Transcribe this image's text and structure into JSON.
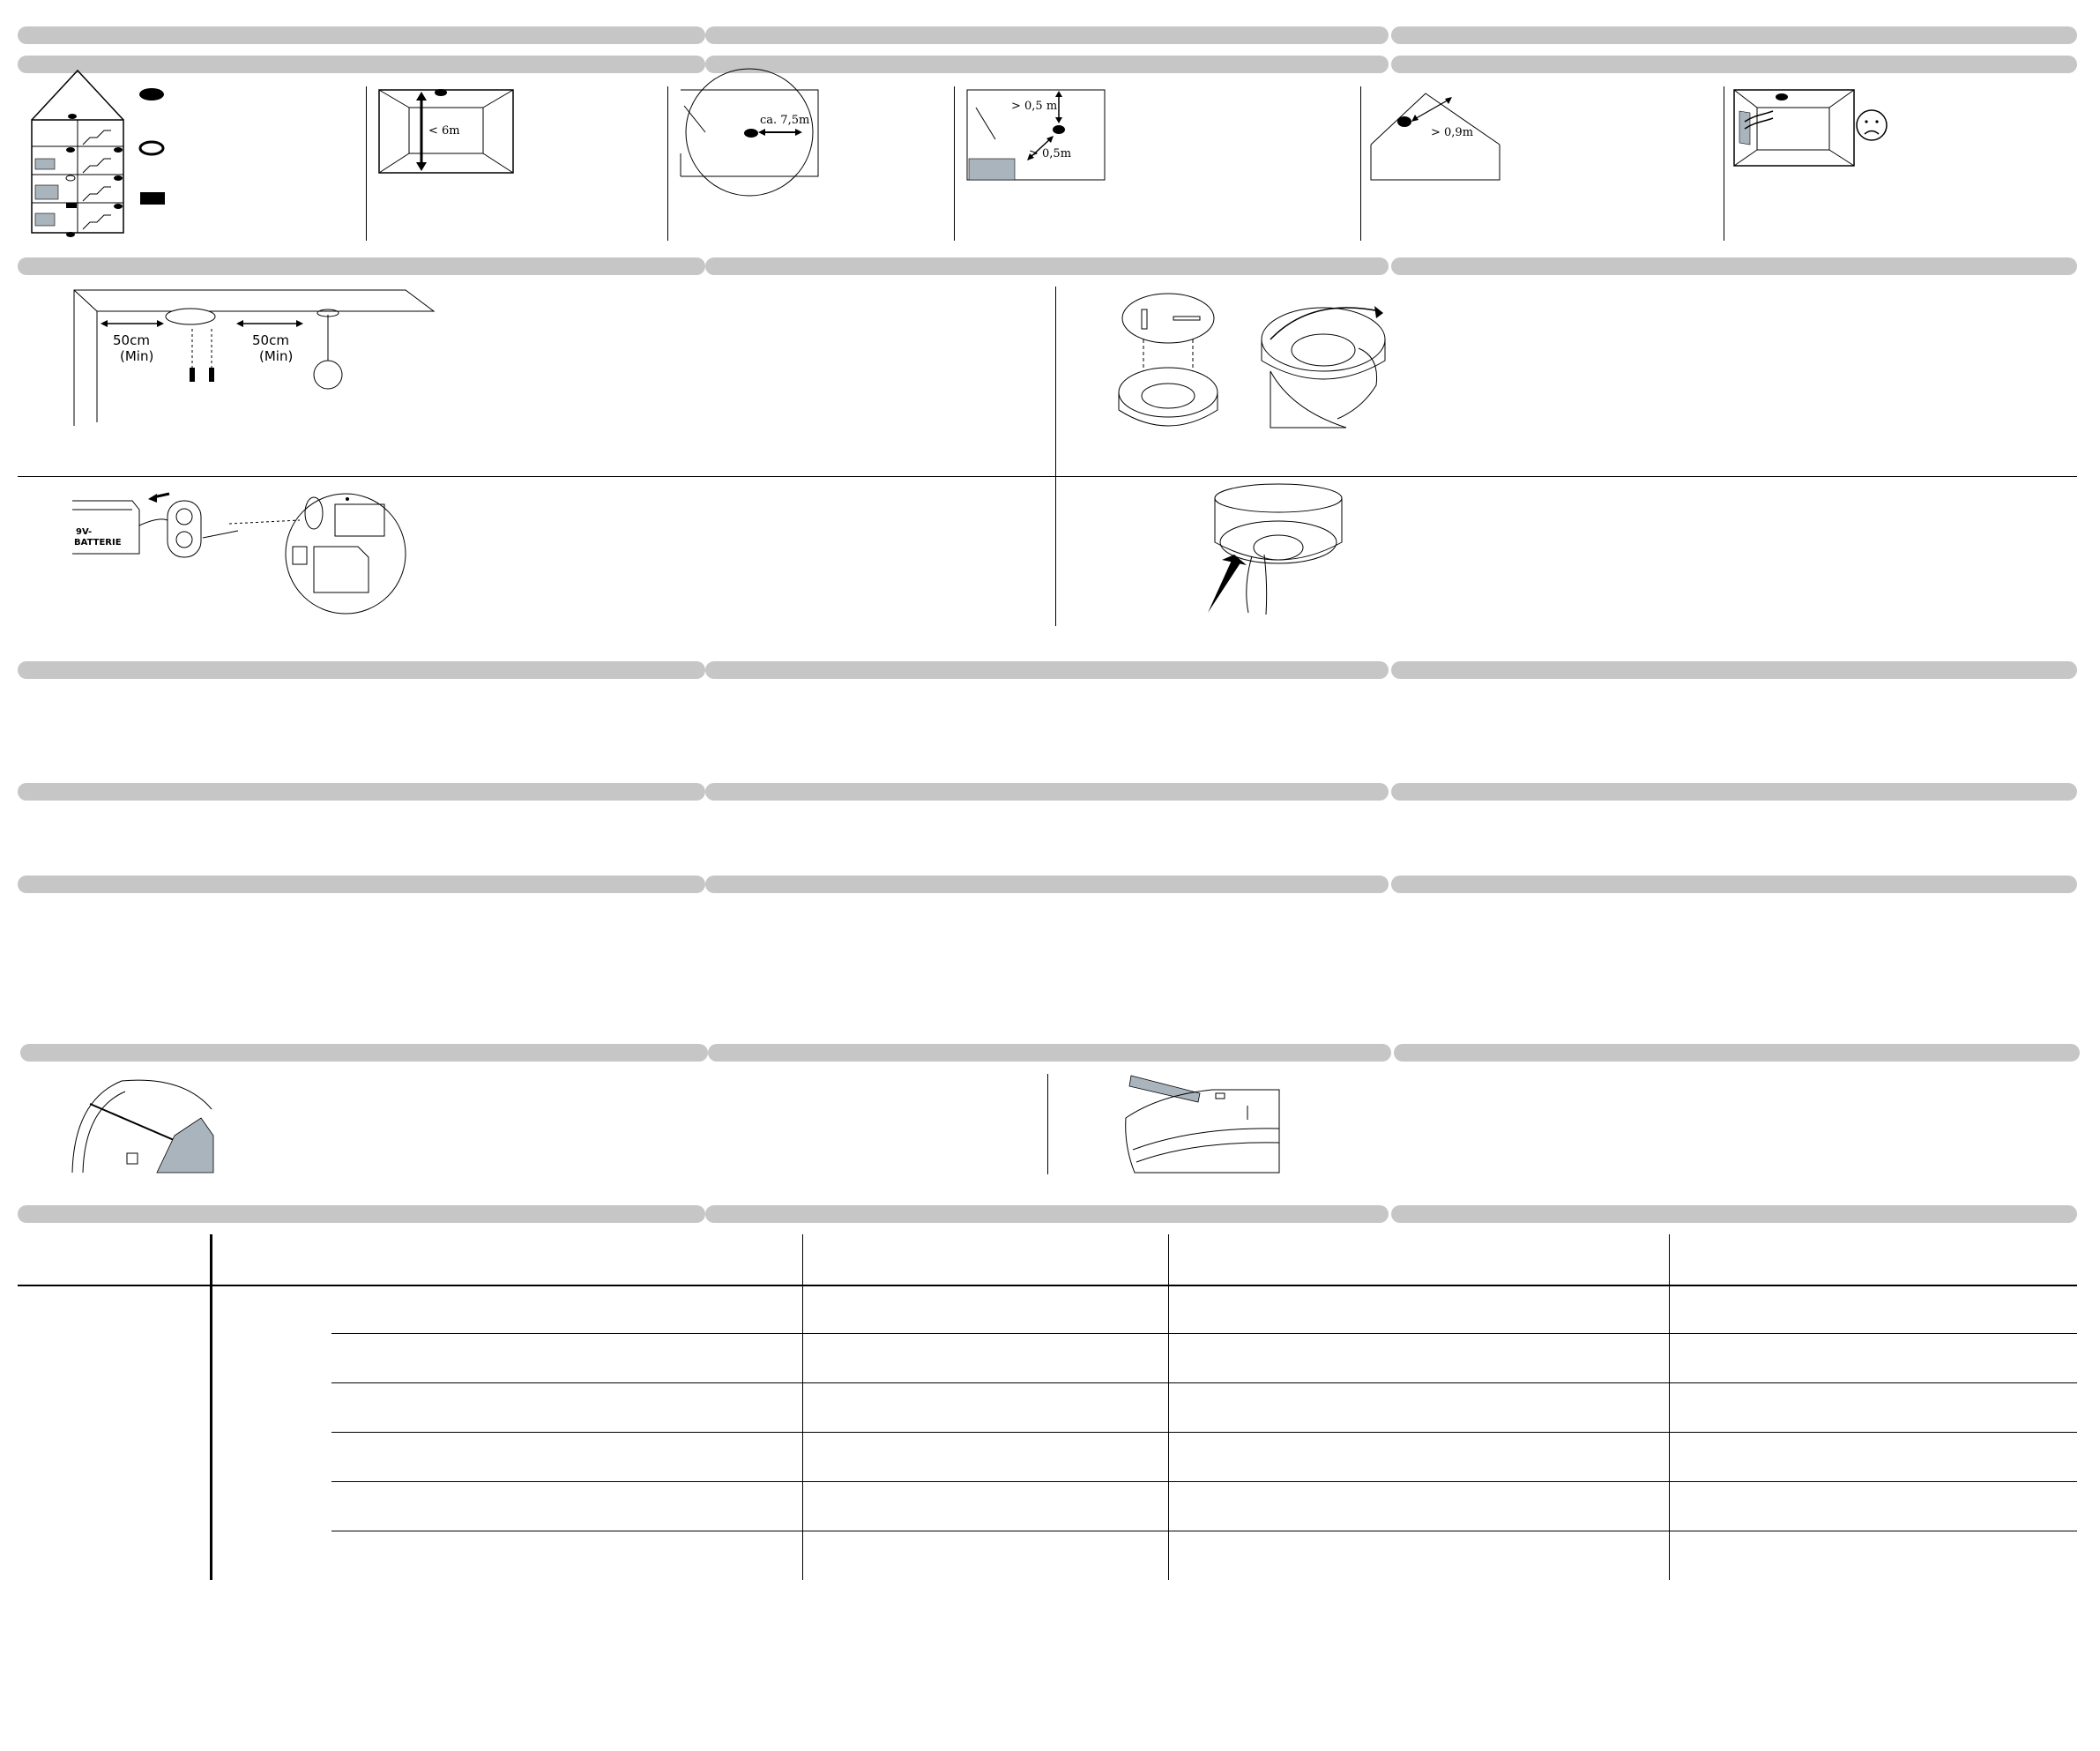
{
  "figures": {
    "ceiling_height": {
      "label": "< 6m"
    },
    "coverage_radius": {
      "label": "ca. 7,5m"
    },
    "wall_clearance": {
      "top_label": "> 0,5 m",
      "side_label": "> 0,5m"
    },
    "roof_peak": {
      "label": "> 0,9m"
    },
    "mounting": {
      "left_distance": "50cm",
      "left_note": "(Min)",
      "right_distance": "50cm",
      "right_note": "(Min)"
    },
    "battery": {
      "label_line1": "9V-",
      "label_line2": "BATTERIE"
    }
  },
  "colors": {
    "section_bar": "#c6c6c6",
    "line": "#000000",
    "fill_gray": "#a9b4bc"
  }
}
